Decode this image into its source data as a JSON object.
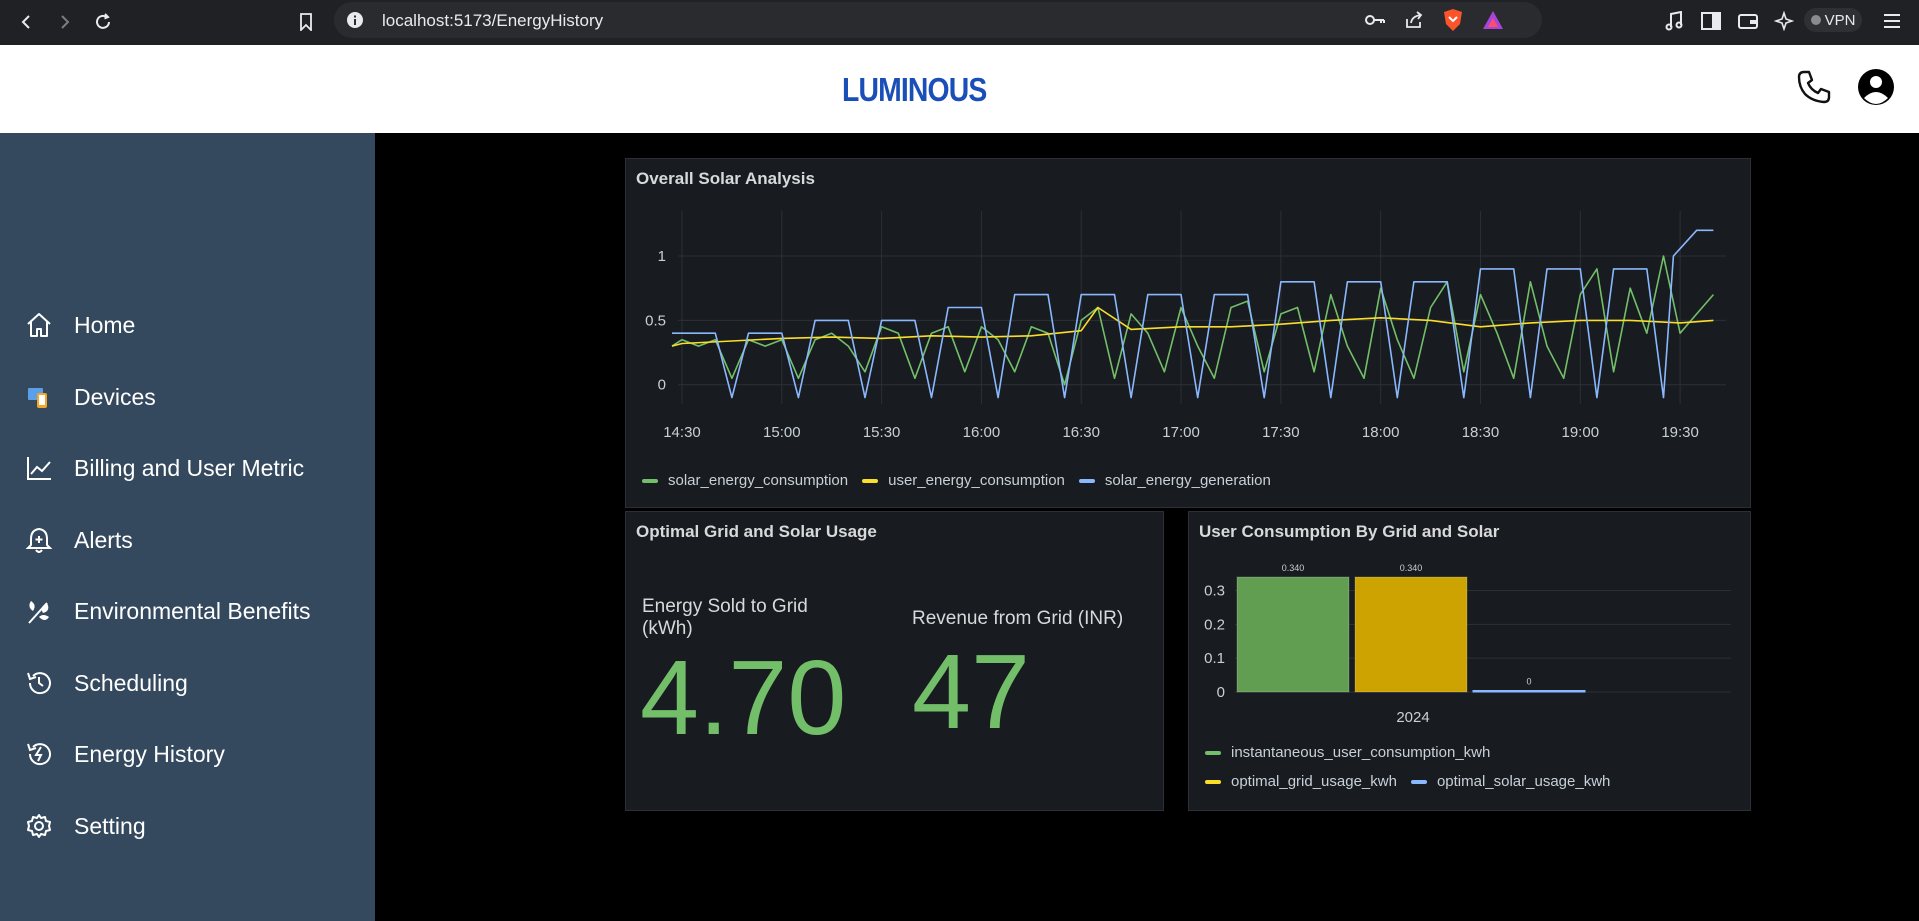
{
  "browser": {
    "url": "localhost:5173/EnergyHistory",
    "vpn_label": "VPN"
  },
  "header": {
    "logo_text": "LUMINOUS"
  },
  "sidebar": {
    "items": [
      {
        "label": "Home",
        "icon": "home-icon"
      },
      {
        "label": "Devices",
        "icon": "devices-icon"
      },
      {
        "label": "Billing and User Metric",
        "icon": "chart-line-icon"
      },
      {
        "label": "Alerts",
        "icon": "bell-icon"
      },
      {
        "label": "Environmental Benefits",
        "icon": "leaf-icon"
      },
      {
        "label": "Scheduling",
        "icon": "history-icon"
      },
      {
        "label": "Energy History",
        "icon": "energy-icon"
      },
      {
        "label": "Setting",
        "icon": "gear-icon"
      }
    ]
  },
  "solar_panel": {
    "title": "Overall Solar Analysis",
    "legend": [
      "solar_energy_consumption",
      "user_energy_consumption",
      "solar_energy_generation"
    ]
  },
  "optimal_panel": {
    "title": "Optimal Grid and Solar Usage",
    "stat1_label_line1": "Energy Sold to Grid",
    "stat1_label_line2": "(kWh)",
    "stat1_value": "4.70",
    "stat2_label": "Revenue from Grid (INR)",
    "stat2_value": "47"
  },
  "consumption_panel": {
    "title": "User Consumption By Grid and Solar",
    "legend": [
      "instantaneous_user_consumption_kwh",
      "optimal_grid_usage_kwh",
      "optimal_solar_usage_kwh"
    ]
  },
  "colors": {
    "green": "#73bf69",
    "yellow": "#fade2a",
    "blue": "#8ab8ff",
    "bar_green": "#629e51",
    "bar_yellow": "#cca300"
  },
  "chart_data": [
    {
      "type": "line",
      "title": "Overall Solar Analysis",
      "x_ticks": [
        "14:30",
        "15:00",
        "15:30",
        "16:00",
        "16:30",
        "17:00",
        "17:30",
        "18:00",
        "18:30",
        "19:00",
        "19:30"
      ],
      "y_ticks": [
        "0",
        "0.5",
        "1"
      ],
      "ylim": [
        -0.15,
        1.35
      ],
      "grid": true,
      "legend_position": "bottom-left",
      "series": [
        {
          "name": "solar_energy_consumption",
          "color": "#73bf69",
          "x": [
            "14:27",
            "14:30",
            "14:35",
            "14:40",
            "14:45",
            "14:50",
            "14:55",
            "15:00",
            "15:05",
            "15:10",
            "15:15",
            "15:20",
            "15:25",
            "15:30",
            "15:35",
            "15:40",
            "15:45",
            "15:50",
            "15:55",
            "16:00",
            "16:05",
            "16:10",
            "16:15",
            "16:20",
            "16:25",
            "16:30",
            "16:35",
            "16:40",
            "16:45",
            "16:50",
            "16:55",
            "17:00",
            "17:05",
            "17:10",
            "17:15",
            "17:20",
            "17:25",
            "17:30",
            "17:35",
            "17:40",
            "17:45",
            "17:50",
            "17:55",
            "18:00",
            "18:05",
            "18:10",
            "18:15",
            "18:20",
            "18:25",
            "18:30",
            "18:35",
            "18:40",
            "18:45",
            "18:50",
            "18:55",
            "19:00",
            "19:05",
            "19:10",
            "19:15",
            "19:20",
            "19:25",
            "19:30",
            "19:35",
            "19:40"
          ],
          "y": [
            0.3,
            0.35,
            0.3,
            0.35,
            0.05,
            0.35,
            0.3,
            0.35,
            0.05,
            0.35,
            0.4,
            0.3,
            0.1,
            0.45,
            0.4,
            0.05,
            0.4,
            0.45,
            0.1,
            0.45,
            0.35,
            0.1,
            0.45,
            0.4,
            0.0,
            0.5,
            0.6,
            0.05,
            0.55,
            0.4,
            0.1,
            0.6,
            0.3,
            0.05,
            0.6,
            0.65,
            0.1,
            0.55,
            0.6,
            0.1,
            0.7,
            0.3,
            0.05,
            0.75,
            0.35,
            0.05,
            0.6,
            0.8,
            0.1,
            0.7,
            0.4,
            0.05,
            0.8,
            0.3,
            0.05,
            0.7,
            0.9,
            0.1,
            0.75,
            0.4,
            1.0,
            0.4,
            0.55,
            0.7
          ]
        },
        {
          "name": "user_energy_consumption",
          "color": "#fade2a",
          "x": [
            "14:27",
            "14:30",
            "14:45",
            "15:00",
            "15:15",
            "15:30",
            "15:45",
            "16:00",
            "16:15",
            "16:30",
            "16:35",
            "16:45",
            "17:00",
            "17:15",
            "17:30",
            "17:45",
            "18:00",
            "18:15",
            "18:30",
            "18:45",
            "19:00",
            "19:15",
            "19:30",
            "19:40"
          ],
          "y": [
            0.3,
            0.32,
            0.34,
            0.36,
            0.37,
            0.36,
            0.38,
            0.37,
            0.38,
            0.42,
            0.6,
            0.43,
            0.45,
            0.45,
            0.47,
            0.5,
            0.52,
            0.5,
            0.45,
            0.48,
            0.5,
            0.5,
            0.48,
            0.5
          ]
        },
        {
          "name": "solar_energy_generation",
          "color": "#8ab8ff",
          "x": [
            "14:27",
            "14:30",
            "14:40",
            "14:45",
            "14:50",
            "15:00",
            "15:05",
            "15:10",
            "15:20",
            "15:25",
            "15:30",
            "15:40",
            "15:45",
            "15:50",
            "16:00",
            "16:05",
            "16:10",
            "16:20",
            "16:25",
            "16:30",
            "16:40",
            "16:45",
            "16:50",
            "17:00",
            "17:05",
            "17:10",
            "17:20",
            "17:25",
            "17:30",
            "17:40",
            "17:45",
            "17:50",
            "18:00",
            "18:05",
            "18:10",
            "18:20",
            "18:25",
            "18:30",
            "18:40",
            "18:45",
            "18:50",
            "19:00",
            "19:05",
            "19:10",
            "19:20",
            "19:25",
            "19:28",
            "19:35",
            "19:40"
          ],
          "y": [
            0.4,
            0.4,
            0.4,
            -0.1,
            0.4,
            0.4,
            -0.1,
            0.5,
            0.5,
            -0.1,
            0.5,
            0.5,
            -0.1,
            0.6,
            0.6,
            -0.1,
            0.7,
            0.7,
            -0.1,
            0.7,
            0.7,
            -0.1,
            0.7,
            0.7,
            -0.1,
            0.7,
            0.7,
            -0.1,
            0.8,
            0.8,
            -0.1,
            0.8,
            0.8,
            -0.1,
            0.8,
            0.8,
            -0.1,
            0.9,
            0.9,
            -0.1,
            0.9,
            0.9,
            -0.1,
            0.9,
            0.9,
            -0.1,
            1.0,
            1.2,
            1.2
          ]
        }
      ]
    },
    {
      "type": "bar",
      "title": "User Consumption By Grid and Solar",
      "categories": [
        "2024"
      ],
      "y_ticks": [
        "0",
        "0.1",
        "0.2",
        "0.3"
      ],
      "ylim": [
        0,
        0.34
      ],
      "legend_position": "bottom-left",
      "series": [
        {
          "name": "instantaneous_user_consumption_kwh",
          "values": [
            0.34
          ],
          "label": "0.340",
          "color": "#629e51"
        },
        {
          "name": "optimal_grid_usage_kwh",
          "values": [
            0.34
          ],
          "label": "0.340",
          "color": "#cca300"
        },
        {
          "name": "optimal_solar_usage_kwh",
          "values": [
            0
          ],
          "label": "0",
          "color": "#8ab8ff"
        }
      ]
    }
  ]
}
